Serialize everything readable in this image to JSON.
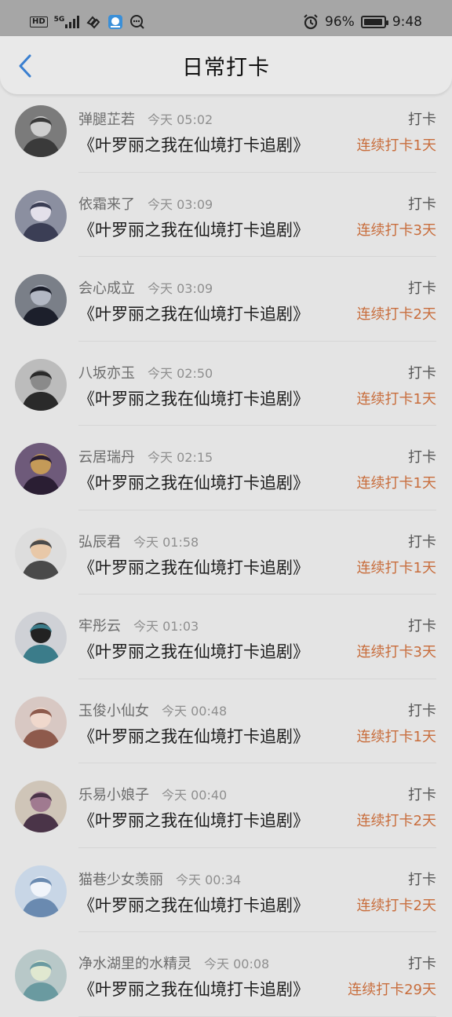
{
  "status_bar": {
    "hd": "HD",
    "net": "5G",
    "battery": "96%",
    "battery_level": 0.96,
    "time": "9:48",
    "icons": [
      "hd-icon",
      "signal-icon",
      "link-icon",
      "app-icon",
      "chat-icon",
      "alarm-icon",
      "battery-icon"
    ]
  },
  "header": {
    "title": "日常打卡",
    "back_icon": "chevron-left-icon"
  },
  "rows": [
    {
      "name": "弹腿芷若",
      "time": "今天 05:02",
      "show": "《叶罗丽之我在仙境打卡追剧》",
      "action": "打卡",
      "streak": "连续打卡1天"
    },
    {
      "name": "依霜来了",
      "time": "今天 03:09",
      "show": "《叶罗丽之我在仙境打卡追剧》",
      "action": "打卡",
      "streak": "连续打卡3天"
    },
    {
      "name": "会心成立",
      "time": "今天 03:09",
      "show": "《叶罗丽之我在仙境打卡追剧》",
      "action": "打卡",
      "streak": "连续打卡2天"
    },
    {
      "name": "八坂亦玉",
      "time": "今天 02:50",
      "show": "《叶罗丽之我在仙境打卡追剧》",
      "action": "打卡",
      "streak": "连续打卡1天"
    },
    {
      "name": "云居瑞丹",
      "time": "今天 02:15",
      "show": "《叶罗丽之我在仙境打卡追剧》",
      "action": "打卡",
      "streak": "连续打卡1天"
    },
    {
      "name": "弘辰君",
      "time": "今天 01:58",
      "show": "《叶罗丽之我在仙境打卡追剧》",
      "action": "打卡",
      "streak": "连续打卡1天"
    },
    {
      "name": "牢彤云",
      "time": "今天 01:03",
      "show": "《叶罗丽之我在仙境打卡追剧》",
      "action": "打卡",
      "streak": "连续打卡3天"
    },
    {
      "name": "玉俊小仙女",
      "time": "今天 00:48",
      "show": "《叶罗丽之我在仙境打卡追剧》",
      "action": "打卡",
      "streak": "连续打卡1天"
    },
    {
      "name": "乐易小娘子",
      "time": "今天 00:40",
      "show": "《叶罗丽之我在仙境打卡追剧》",
      "action": "打卡",
      "streak": "连续打卡2天"
    },
    {
      "name": "猫巷少女羡丽",
      "time": "今天 00:34",
      "show": "《叶罗丽之我在仙境打卡追剧》",
      "action": "打卡",
      "streak": "连续打卡2天"
    },
    {
      "name": "净水湖里的水精灵",
      "time": "今天 00:08",
      "show": "《叶罗丽之我在仙境打卡追剧》",
      "action": "打卡",
      "streak": "连续打卡29天"
    }
  ],
  "colors": {
    "streak": "#c86d3c",
    "back": "#3a7fd0",
    "status_bar_bg": "#a6a6a6"
  }
}
